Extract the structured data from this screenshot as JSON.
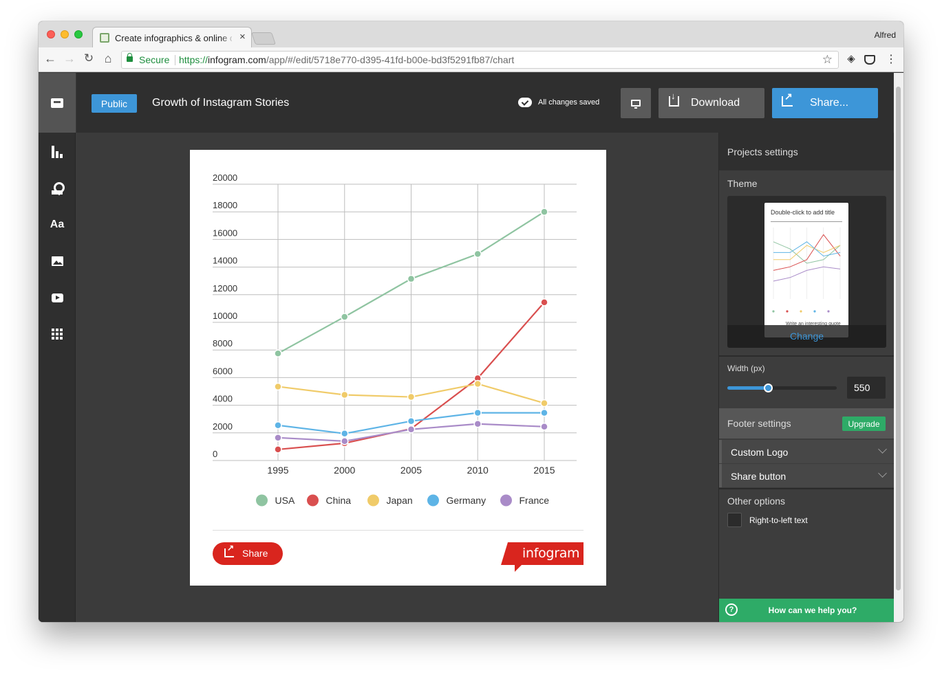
{
  "browser": {
    "tab_title": "Create infographics & online ch",
    "profile": "Alfred",
    "secure_label": "Secure",
    "url_scheme": "https://",
    "url_host": "infogram.com",
    "url_path": "/app/#/edit/5718e770-d395-41fd-b00e-bd3f5291fb87/chart"
  },
  "topbar": {
    "public_label": "Public",
    "project_title": "Growth of Instagram Stories",
    "saved_status": "All changes saved",
    "download_label": "Download",
    "share_label": "Share..."
  },
  "sidebar": {
    "items": [
      "home",
      "charts",
      "maps",
      "text",
      "images",
      "video",
      "more"
    ],
    "text_icon_glyph": "Aa"
  },
  "card": {
    "share_label": "Share",
    "brand": "infogram"
  },
  "chart_data": {
    "type": "line",
    "categories": [
      "1995",
      "2000",
      "2005",
      "2010",
      "2015"
    ],
    "ylim": [
      0,
      20000
    ],
    "yticks": [
      "0",
      "2000",
      "4000",
      "6000",
      "8000",
      "10000",
      "12000",
      "14000",
      "16000",
      "18000",
      "20000"
    ],
    "grid": true,
    "legend_position": "bottom",
    "series": [
      {
        "name": "USA",
        "color": "#8fc4a1",
        "values": [
          7750,
          10400,
          13150,
          14950,
          18000
        ]
      },
      {
        "name": "China",
        "color": "#d94f4f",
        "values": [
          800,
          1250,
          2300,
          5950,
          11450
        ]
      },
      {
        "name": "Japan",
        "color": "#f0cb69",
        "values": [
          5350,
          4750,
          4600,
          5550,
          4150
        ]
      },
      {
        "name": "Germany",
        "color": "#5eb4e6",
        "values": [
          2550,
          1950,
          2850,
          3450,
          3450
        ]
      },
      {
        "name": "France",
        "color": "#a98bc8",
        "values": [
          1650,
          1400,
          2250,
          2650,
          2450
        ]
      }
    ]
  },
  "right_panel": {
    "projects_settings": "Projects settings",
    "theme_label": "Theme",
    "theme_thumb_title": "Double-click to add title",
    "theme_thumb_quote": "Write an interesting quote",
    "theme_change": "Change",
    "width_label": "Width (px)",
    "width_value": "550",
    "width_slider_fraction": 0.37,
    "footer_settings": "Footer settings",
    "upgrade_label": "Upgrade",
    "custom_logo": "Custom Logo",
    "share_button": "Share button",
    "other_options": "Other options",
    "rtl_label": "Right-to-left text",
    "help_text": "How can we help you?"
  },
  "colors": {
    "accent_blue": "#3d96d8",
    "brand_red": "#d9251e",
    "help_green": "#2eab67"
  }
}
